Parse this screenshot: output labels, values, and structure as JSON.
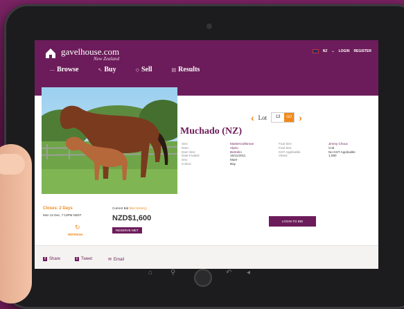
{
  "brand": {
    "name": "gavelhouse.com",
    "region": "New Zealand"
  },
  "topbar": {
    "country": "NZ",
    "login": "LOGIN",
    "register": "REGISTER"
  },
  "nav": [
    {
      "label": "Browse"
    },
    {
      "label": "Buy"
    },
    {
      "label": "Sell"
    },
    {
      "label": "Results"
    }
  ],
  "lot": {
    "label": "Lot",
    "number": "13",
    "go": "GO"
  },
  "horse": {
    "name": "Muchado (NZ)",
    "details_left": [
      {
        "label": "Sire:",
        "value": "Mastercraftsman"
      },
      {
        "label": "Dam:",
        "value": "Alpiro"
      },
      {
        "label": "Dam Sire:",
        "value": "Bertolini"
      },
      {
        "label": "Date Foaled:",
        "value": "15/11/2011"
      },
      {
        "label": "Sex:",
        "value": "Mare"
      },
      {
        "label": "Colour:",
        "value": "Bay"
      }
    ],
    "details_right": [
      {
        "label": "Foal Sire:",
        "value": "Jimmy Choux"
      },
      {
        "label": "Foal Sex:",
        "value": "Colt"
      },
      {
        "label": "GST Applicable",
        "value": "No GST Applicable"
      },
      {
        "label": "Views:",
        "value": "1,090"
      }
    ]
  },
  "closing": {
    "title": "Closes: 2 Days",
    "date": "Mon 12 Dec, 7:13PM NZDT",
    "refresh": "REFRESH"
  },
  "bid": {
    "label": "Current Bid",
    "history": "(Bid History)",
    "amount": "NZD$1,600",
    "reserve": "RESERVE MET",
    "login_to_bid": "LOGIN TO BID"
  },
  "share": [
    {
      "label": "Share",
      "icon": "facebook-icon"
    },
    {
      "label": "Tweet",
      "icon": "twitter-icon"
    },
    {
      "label": "Email",
      "icon": "mail-icon"
    }
  ],
  "colors": {
    "brand_purple": "#6c1c5a",
    "accent_orange": "#f08a1c"
  }
}
